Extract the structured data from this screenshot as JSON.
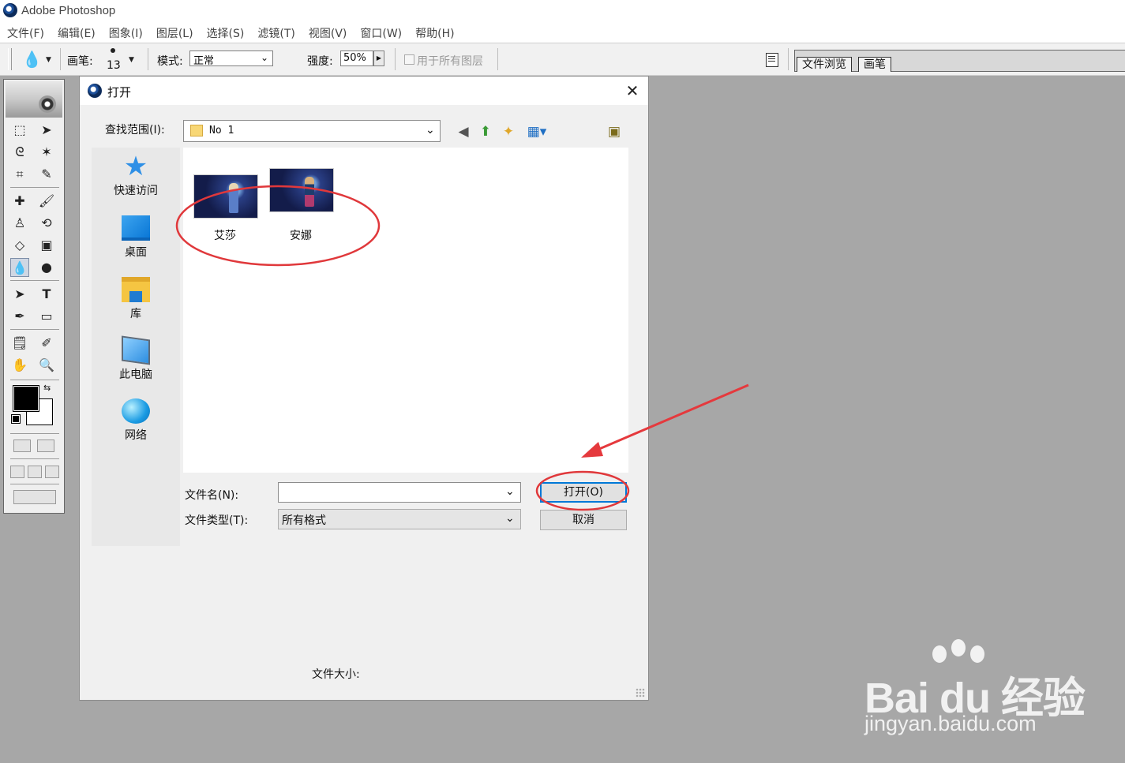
{
  "app": {
    "title": "Adobe Photoshop"
  },
  "menu": [
    "文件(F)",
    "编辑(E)",
    "图象(I)",
    "图层(L)",
    "选择(S)",
    "滤镜(T)",
    "视图(V)",
    "窗口(W)",
    "帮助(H)"
  ],
  "options": {
    "brush_label": "画笔:",
    "brush_size": "13",
    "mode_label": "模式:",
    "mode_value": "正常",
    "strength_label": "强度:",
    "strength_value": "50%",
    "use_all_layers_label": "用于所有图层",
    "palette_tabs": [
      "文件浏览",
      "画笔"
    ]
  },
  "dialog": {
    "title": "打开",
    "look_in_label": "查找范围(I):",
    "look_in_value": "No 1",
    "places": [
      "快速访问",
      "桌面",
      "库",
      "此电脑",
      "网络"
    ],
    "files": [
      {
        "name": "艾莎",
        "icon": "image-thumbnail-elsa"
      },
      {
        "name": "安娜",
        "icon": "image-thumbnail-anna"
      }
    ],
    "file_name_label": "文件名(N):",
    "file_name_value": "",
    "file_type_label": "文件类型(T):",
    "file_type_value": "所有格式",
    "open_label": "打开(O)",
    "cancel_label": "取消",
    "file_size_label": "文件大小:"
  },
  "annotation_colors": {
    "circle": "#e0383b",
    "arrow": "#e5393d"
  },
  "watermark": {
    "logo_text": "Bai du 经验",
    "url": "jingyan.baidu.com"
  }
}
